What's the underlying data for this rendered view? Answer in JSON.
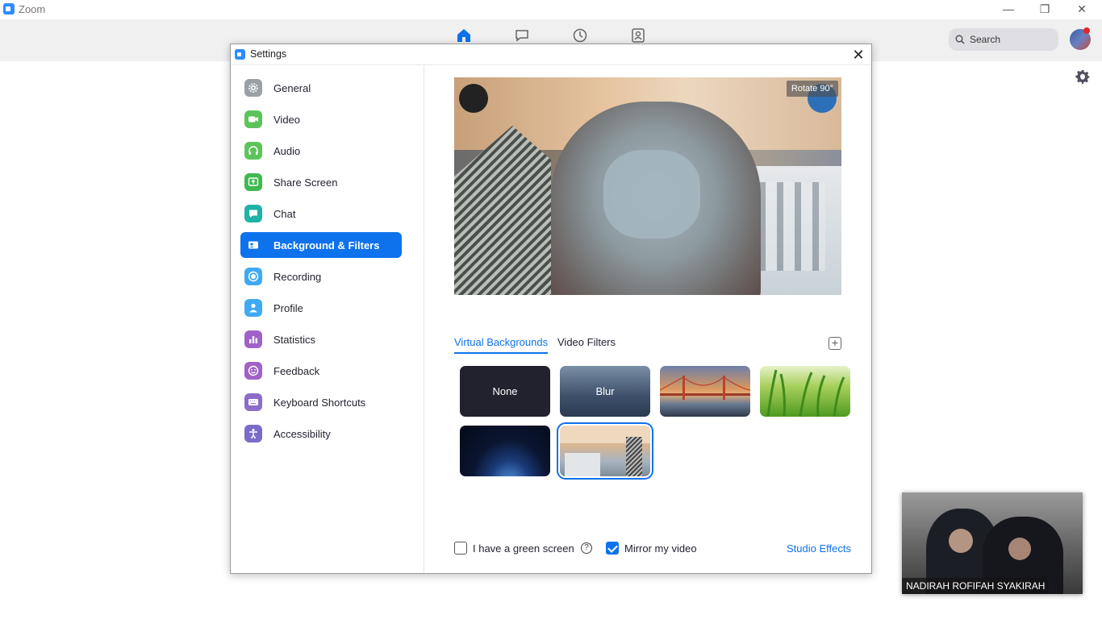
{
  "app": {
    "title": "Zoom"
  },
  "window_controls": {
    "minimize": "—",
    "restore": "❐",
    "close": "✕"
  },
  "topnav": {
    "icons": [
      "home-icon",
      "chat-icon",
      "clock-icon",
      "contacts-icon"
    ],
    "search_label": "Search"
  },
  "dialog": {
    "title": "Settings",
    "close_glyph": "✕",
    "sidebar": [
      {
        "label": "General",
        "icon": "gear-icon",
        "color": "#9aa0a6"
      },
      {
        "label": "Video",
        "icon": "video-camera-icon",
        "color": "#5cc45a"
      },
      {
        "label": "Audio",
        "icon": "headphones-icon",
        "color": "#5cc45a"
      },
      {
        "label": "Share Screen",
        "icon": "share-screen-icon",
        "color": "#3fb950"
      },
      {
        "label": "Chat",
        "icon": "chat-bubble-icon",
        "color": "#1fb2a6"
      },
      {
        "label": "Background & Filters",
        "icon": "person-card-icon",
        "color": "#0E72ED",
        "active": true
      },
      {
        "label": "Recording",
        "icon": "record-icon",
        "color": "#3fa9f5"
      },
      {
        "label": "Profile",
        "icon": "person-icon",
        "color": "#3fa9f5"
      },
      {
        "label": "Statistics",
        "icon": "bar-chart-icon",
        "color": "#a062c8"
      },
      {
        "label": "Feedback",
        "icon": "smiley-icon",
        "color": "#a062c8"
      },
      {
        "label": "Keyboard Shortcuts",
        "icon": "keyboard-icon",
        "color": "#8c6cc8"
      },
      {
        "label": "Accessibility",
        "icon": "accessibility-icon",
        "color": "#7a6cc8"
      }
    ],
    "preview": {
      "rotate_label": "Rotate 90°"
    },
    "tabs": [
      {
        "label": "Virtual Backgrounds",
        "active": true
      },
      {
        "label": "Video Filters",
        "active": false
      }
    ],
    "backgrounds": [
      {
        "label": "None",
        "style": "none"
      },
      {
        "label": "Blur",
        "style": "blur"
      },
      {
        "label": "",
        "style": "bridge"
      },
      {
        "label": "",
        "style": "grass"
      },
      {
        "label": "",
        "style": "earth"
      },
      {
        "label": "",
        "style": "custom",
        "selected": true
      }
    ],
    "options": {
      "green_screen_label": "I have a green screen",
      "green_screen_checked": false,
      "help_glyph": "?",
      "mirror_label": "Mirror my video",
      "mirror_checked": true,
      "studio_effects_label": "Studio Effects"
    }
  },
  "floating_video": {
    "name": "NADIRAH ROFIFAH SYAKIRAH"
  }
}
